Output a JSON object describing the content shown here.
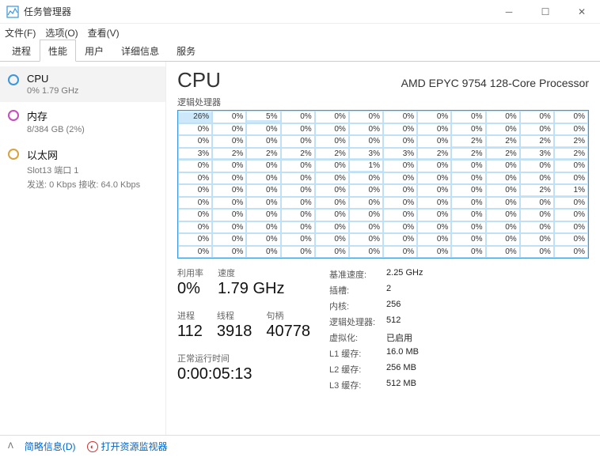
{
  "window": {
    "title": "任务管理器"
  },
  "menu": {
    "file": "文件(F)",
    "options": "选项(O)",
    "view": "查看(V)"
  },
  "tabs": [
    "进程",
    "性能",
    "用户",
    "详细信息",
    "服务"
  ],
  "active_tab": 1,
  "sidebar": {
    "items": [
      {
        "label": "CPU",
        "sub": "0% 1.79 GHz"
      },
      {
        "label": "内存",
        "sub": "8/384 GB (2%)"
      },
      {
        "label": "以太网",
        "sub": "Slot13 端口 1",
        "sub2": "发送: 0 Kbps 接收: 64.0 Kbps"
      }
    ]
  },
  "main": {
    "title": "CPU",
    "processor": "AMD EPYC 9754 128-Core Processor",
    "graph_label": "逻辑处理器",
    "stats_left": [
      [
        {
          "k": "利用率",
          "v": "0%"
        },
        {
          "k": "速度",
          "v": "1.79 GHz"
        }
      ],
      [
        {
          "k": "进程",
          "v": "112"
        },
        {
          "k": "线程",
          "v": "3918"
        },
        {
          "k": "句柄",
          "v": "40778"
        }
      ]
    ],
    "uptime": {
      "k": "正常运行时间",
      "v": "0:00:05:13"
    },
    "stats_right": [
      {
        "k": "基准速度:",
        "v": "2.25 GHz"
      },
      {
        "k": "插槽:",
        "v": "2"
      },
      {
        "k": "内核:",
        "v": "256"
      },
      {
        "k": "逻辑处理器:",
        "v": "512"
      },
      {
        "k": "虚拟化:",
        "v": "已启用"
      },
      {
        "k": "L1 缓存:",
        "v": "16.0 MB"
      },
      {
        "k": "L2 缓存:",
        "v": "256 MB"
      },
      {
        "k": "L3 缓存:",
        "v": "512 MB"
      }
    ]
  },
  "footer": {
    "brief": "简略信息(D)",
    "resmon": "打开资源监视器"
  },
  "chart_data": {
    "type": "heatmap",
    "title": "逻辑处理器",
    "cols": 12,
    "rows": 12,
    "unit": "%",
    "values": [
      [
        26,
        0,
        5,
        0,
        0,
        0,
        0,
        0,
        0,
        0,
        0,
        0
      ],
      [
        0,
        0,
        0,
        0,
        0,
        0,
        0,
        0,
        0,
        0,
        0,
        0
      ],
      [
        0,
        0,
        0,
        0,
        0,
        0,
        0,
        0,
        2,
        2,
        2,
        2
      ],
      [
        3,
        2,
        2,
        2,
        2,
        3,
        3,
        2,
        2,
        2,
        3,
        2
      ],
      [
        0,
        0,
        0,
        0,
        0,
        1,
        0,
        0,
        0,
        0,
        0,
        0
      ],
      [
        0,
        0,
        0,
        0,
        0,
        0,
        0,
        0,
        0,
        0,
        0,
        0
      ],
      [
        0,
        0,
        0,
        0,
        0,
        0,
        0,
        0,
        0,
        0,
        2,
        1
      ],
      [
        0,
        0,
        0,
        0,
        0,
        0,
        0,
        0,
        0,
        0,
        0,
        0
      ],
      [
        0,
        0,
        0,
        0,
        0,
        0,
        0,
        0,
        0,
        0,
        0,
        0
      ],
      [
        0,
        0,
        0,
        0,
        0,
        0,
        0,
        0,
        0,
        0,
        0,
        0
      ],
      [
        0,
        0,
        0,
        0,
        0,
        0,
        0,
        0,
        0,
        0,
        0,
        0
      ],
      [
        0,
        0,
        0,
        0,
        0,
        0,
        0,
        0,
        0,
        0,
        0,
        0
      ]
    ]
  }
}
